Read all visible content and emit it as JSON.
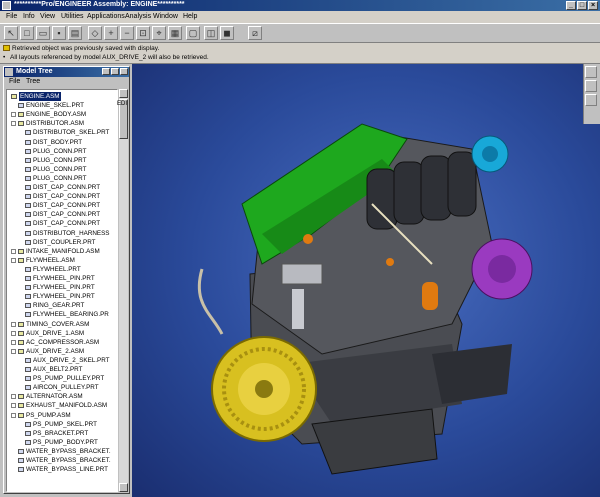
{
  "window": {
    "title": "**********Pro/ENGINEER Assembly: ENGINE**********"
  },
  "menu": [
    "File",
    "Info",
    "View",
    "Utilities",
    "Applications",
    "Analysis",
    "Window",
    "Help"
  ],
  "messages": [
    "Retrieved object was previously saved with display.",
    "All layouts referenced by model AUX_DRIVE_2 will also be retrieved."
  ],
  "model_tree": {
    "title": "Model Tree",
    "menu": [
      "File",
      "Tree"
    ],
    "side_label": "EDI",
    "items": [
      {
        "label": "ENGINE.ASM",
        "level": 0,
        "type": "asm",
        "expand": "",
        "selected": true
      },
      {
        "label": "ENGINE_SKEL.PRT",
        "level": 1,
        "type": "prt",
        "expand": ""
      },
      {
        "label": "ENGINE_BODY.ASM",
        "level": 1,
        "type": "asm",
        "expand": "+"
      },
      {
        "label": "DISTRIBUTOR.ASM",
        "level": 1,
        "type": "asm",
        "expand": "-"
      },
      {
        "label": "DISTRIBUTOR_SKEL.PRT",
        "level": 2,
        "type": "prt",
        "expand": ""
      },
      {
        "label": "DIST_BODY.PRT",
        "level": 2,
        "type": "prt",
        "expand": ""
      },
      {
        "label": "PLUG_CONN.PRT",
        "level": 2,
        "type": "prt",
        "expand": ""
      },
      {
        "label": "PLUG_CONN.PRT",
        "level": 2,
        "type": "prt",
        "expand": ""
      },
      {
        "label": "PLUG_CONN.PRT",
        "level": 2,
        "type": "prt",
        "expand": ""
      },
      {
        "label": "PLUG_CONN.PRT",
        "level": 2,
        "type": "prt",
        "expand": ""
      },
      {
        "label": "DIST_CAP_CONN.PRT",
        "level": 2,
        "type": "prt",
        "expand": ""
      },
      {
        "label": "DIST_CAP_CONN.PRT",
        "level": 2,
        "type": "prt",
        "expand": ""
      },
      {
        "label": "DIST_CAP_CONN.PRT",
        "level": 2,
        "type": "prt",
        "expand": ""
      },
      {
        "label": "DIST_CAP_CONN.PRT",
        "level": 2,
        "type": "prt",
        "expand": ""
      },
      {
        "label": "DIST_CAP_CONN.PRT",
        "level": 2,
        "type": "prt",
        "expand": ""
      },
      {
        "label": "DISTRIBUTOR_HARNESS",
        "level": 2,
        "type": "prt",
        "expand": ""
      },
      {
        "label": "DIST_COUPLER.PRT",
        "level": 2,
        "type": "prt",
        "expand": ""
      },
      {
        "label": "INTAKE_MANIFOLD.ASM",
        "level": 1,
        "type": "asm",
        "expand": "+"
      },
      {
        "label": "FLYWHEEL.ASM",
        "level": 1,
        "type": "asm",
        "expand": "-"
      },
      {
        "label": "FLYWHEEL.PRT",
        "level": 2,
        "type": "prt",
        "expand": ""
      },
      {
        "label": "FLYWHEEL_PIN.PRT",
        "level": 2,
        "type": "prt",
        "expand": ""
      },
      {
        "label": "FLYWHEEL_PIN.PRT",
        "level": 2,
        "type": "prt",
        "expand": ""
      },
      {
        "label": "FLYWHEEL_PIN.PRT",
        "level": 2,
        "type": "prt",
        "expand": ""
      },
      {
        "label": "RING_GEAR.PRT",
        "level": 2,
        "type": "prt",
        "expand": ""
      },
      {
        "label": "FLYWHEEL_BEARING.PR",
        "level": 2,
        "type": "prt",
        "expand": ""
      },
      {
        "label": "TIMING_COVER.ASM",
        "level": 1,
        "type": "asm",
        "expand": "+"
      },
      {
        "label": "AUX_DRIVE_1.ASM",
        "level": 1,
        "type": "asm",
        "expand": "+"
      },
      {
        "label": "AC_COMPRESSOR.ASM",
        "level": 1,
        "type": "asm",
        "expand": "+"
      },
      {
        "label": "AUX_DRIVE_2.ASM",
        "level": 1,
        "type": "asm",
        "expand": "-"
      },
      {
        "label": "AUX_DRIVE_2_SKEL.PRT",
        "level": 2,
        "type": "prt",
        "expand": ""
      },
      {
        "label": "AUX_BELT2.PRT",
        "level": 2,
        "type": "prt",
        "expand": ""
      },
      {
        "label": "PS_PUMP_PULLEY.PRT",
        "level": 2,
        "type": "prt",
        "expand": ""
      },
      {
        "label": "AIRCON_PULLEY.PRT",
        "level": 2,
        "type": "prt",
        "expand": ""
      },
      {
        "label": "ALTERNATOR.ASM",
        "level": 1,
        "type": "asm",
        "expand": "+"
      },
      {
        "label": "EXHAUST_MANIFOLD.ASM",
        "level": 1,
        "type": "asm",
        "expand": "+"
      },
      {
        "label": "PS_PUMP.ASM",
        "level": 1,
        "type": "asm",
        "expand": "-"
      },
      {
        "label": "PS_PUMP_SKEL.PRT",
        "level": 2,
        "type": "prt",
        "expand": ""
      },
      {
        "label": "PS_BRACKET.PRT",
        "level": 2,
        "type": "prt",
        "expand": ""
      },
      {
        "label": "PS_PUMP_BODY.PRT",
        "level": 2,
        "type": "prt",
        "expand": ""
      },
      {
        "label": "WATER_BYPASS_BRACKET.",
        "level": 1,
        "type": "prt",
        "expand": ""
      },
      {
        "label": "WATER_BYPASS_BRACKET.",
        "level": 1,
        "type": "prt",
        "expand": ""
      },
      {
        "label": "WATER_BYPASS_LINE.PRT",
        "level": 1,
        "type": "prt",
        "expand": ""
      }
    ]
  },
  "colors": {
    "title_bar": "#0a246a",
    "viewport_bg": "#2a4a9a",
    "head_green": "#1ea81e",
    "distributor_cyan": "#18a8d8",
    "alternator_purple": "#9a3ac0",
    "flywheel_yellow": "#d8c020",
    "accent_orange": "#e07a10"
  }
}
